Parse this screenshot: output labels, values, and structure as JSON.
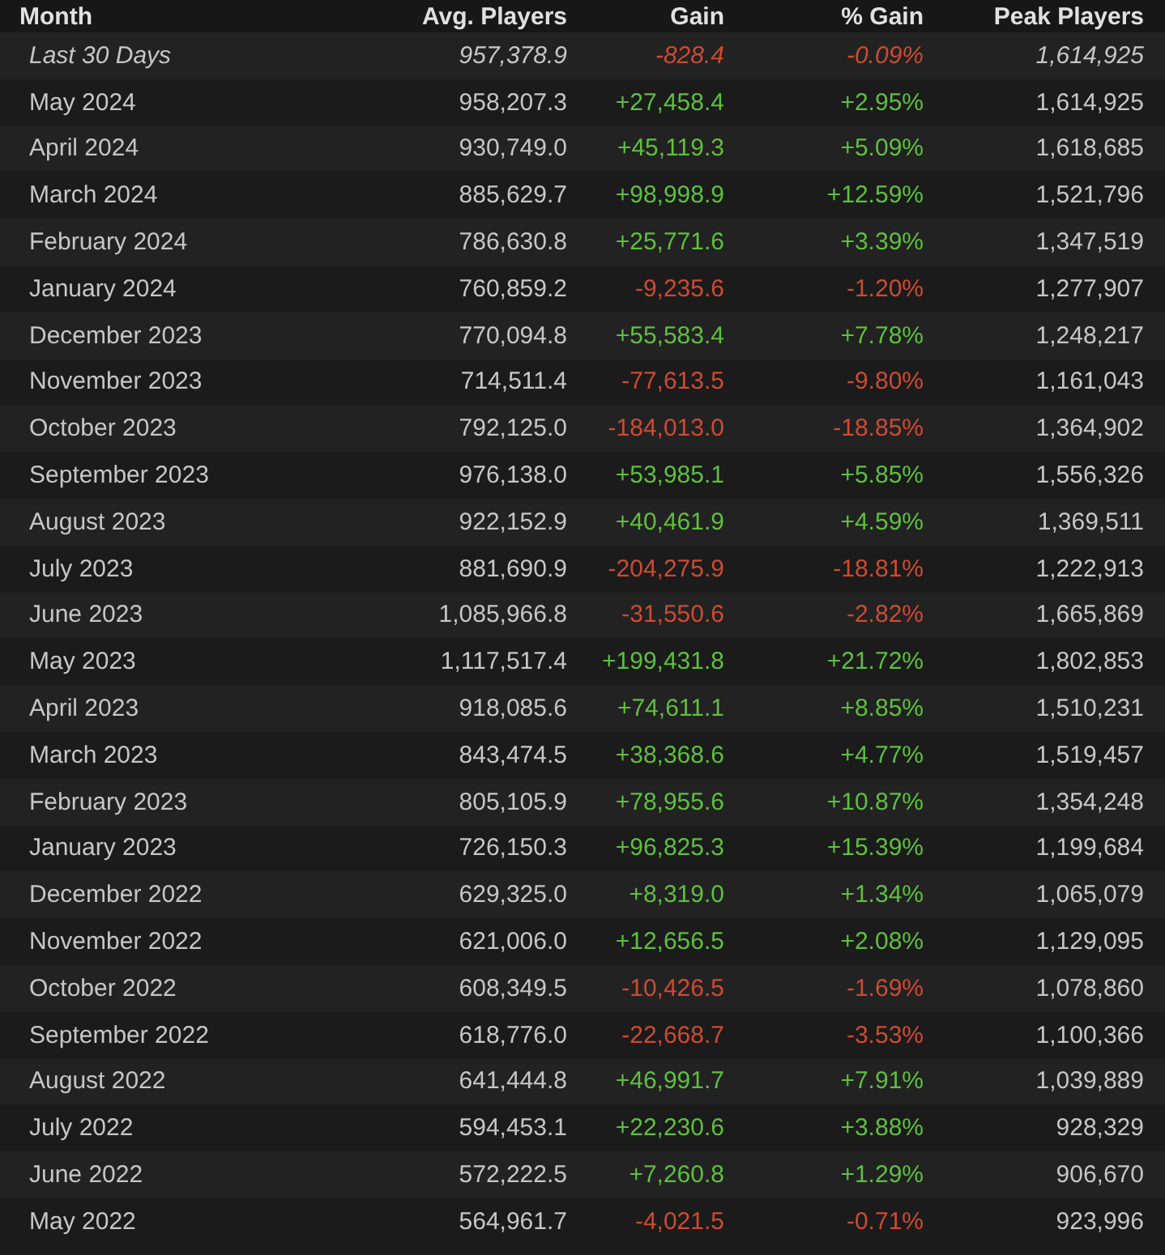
{
  "table": {
    "columns": [
      "Month",
      "Avg. Players",
      "Gain",
      "% Gain",
      "Peak Players"
    ],
    "rows": [
      {
        "kind": "summary",
        "rising": false,
        "cells": [
          "Last 30 Days",
          "957,378.9",
          "-828.4",
          "-0.09%",
          "1,614,925"
        ]
      },
      {
        "kind": "month",
        "rising": true,
        "cells": [
          "May 2024",
          "958,207.3",
          "+27,458.4",
          "+2.95%",
          "1,614,925"
        ]
      },
      {
        "kind": "month",
        "rising": true,
        "cells": [
          "April 2024",
          "930,749.0",
          "+45,119.3",
          "+5.09%",
          "1,618,685"
        ]
      },
      {
        "kind": "month",
        "rising": true,
        "cells": [
          "March 2024",
          "885,629.7",
          "+98,998.9",
          "+12.59%",
          "1,521,796"
        ]
      },
      {
        "kind": "month",
        "rising": true,
        "cells": [
          "February 2024",
          "786,630.8",
          "+25,771.6",
          "+3.39%",
          "1,347,519"
        ]
      },
      {
        "kind": "month",
        "rising": false,
        "cells": [
          "January 2024",
          "760,859.2",
          "-9,235.6",
          "-1.20%",
          "1,277,907"
        ]
      },
      {
        "kind": "month",
        "rising": true,
        "cells": [
          "December 2023",
          "770,094.8",
          "+55,583.4",
          "+7.78%",
          "1,248,217"
        ]
      },
      {
        "kind": "month",
        "rising": false,
        "cells": [
          "November 2023",
          "714,511.4",
          "-77,613.5",
          "-9.80%",
          "1,161,043"
        ]
      },
      {
        "kind": "month",
        "rising": false,
        "cells": [
          "October 2023",
          "792,125.0",
          "-184,013.0",
          "-18.85%",
          "1,364,902"
        ]
      },
      {
        "kind": "month",
        "rising": true,
        "cells": [
          "September 2023",
          "976,138.0",
          "+53,985.1",
          "+5.85%",
          "1,556,326"
        ]
      },
      {
        "kind": "month",
        "rising": true,
        "cells": [
          "August 2023",
          "922,152.9",
          "+40,461.9",
          "+4.59%",
          "1,369,511"
        ]
      },
      {
        "kind": "month",
        "rising": false,
        "cells": [
          "July 2023",
          "881,690.9",
          "-204,275.9",
          "-18.81%",
          "1,222,913"
        ]
      },
      {
        "kind": "month",
        "rising": false,
        "cells": [
          "June 2023",
          "1,085,966.8",
          "-31,550.6",
          "-2.82%",
          "1,665,869"
        ]
      },
      {
        "kind": "month",
        "rising": true,
        "cells": [
          "May 2023",
          "1,117,517.4",
          "+199,431.8",
          "+21.72%",
          "1,802,853"
        ]
      },
      {
        "kind": "month",
        "rising": true,
        "cells": [
          "April 2023",
          "918,085.6",
          "+74,611.1",
          "+8.85%",
          "1,510,231"
        ]
      },
      {
        "kind": "month",
        "rising": true,
        "cells": [
          "March 2023",
          "843,474.5",
          "+38,368.6",
          "+4.77%",
          "1,519,457"
        ]
      },
      {
        "kind": "month",
        "rising": true,
        "cells": [
          "February 2023",
          "805,105.9",
          "+78,955.6",
          "+10.87%",
          "1,354,248"
        ]
      },
      {
        "kind": "month",
        "rising": true,
        "cells": [
          "January 2023",
          "726,150.3",
          "+96,825.3",
          "+15.39%",
          "1,199,684"
        ]
      },
      {
        "kind": "month",
        "rising": true,
        "cells": [
          "December 2022",
          "629,325.0",
          "+8,319.0",
          "+1.34%",
          "1,065,079"
        ]
      },
      {
        "kind": "month",
        "rising": true,
        "cells": [
          "November 2022",
          "621,006.0",
          "+12,656.5",
          "+2.08%",
          "1,129,095"
        ]
      },
      {
        "kind": "month",
        "rising": false,
        "cells": [
          "October 2022",
          "608,349.5",
          "-10,426.5",
          "-1.69%",
          "1,078,860"
        ]
      },
      {
        "kind": "month",
        "rising": false,
        "cells": [
          "September 2022",
          "618,776.0",
          "-22,668.7",
          "-3.53%",
          "1,100,366"
        ]
      },
      {
        "kind": "month",
        "rising": true,
        "cells": [
          "August 2022",
          "641,444.8",
          "+46,991.7",
          "+7.91%",
          "1,039,889"
        ]
      },
      {
        "kind": "month",
        "rising": true,
        "cells": [
          "July 2022",
          "594,453.1",
          "+22,230.6",
          "+3.88%",
          "928,329"
        ]
      },
      {
        "kind": "month",
        "rising": true,
        "cells": [
          "June 2022",
          "572,222.5",
          "+7,260.8",
          "+1.29%",
          "906,670"
        ]
      },
      {
        "kind": "month",
        "rising": false,
        "cells": [
          "May 2022",
          "564,961.7",
          "-4,021.5",
          "-0.71%",
          "923,996"
        ]
      }
    ]
  }
}
